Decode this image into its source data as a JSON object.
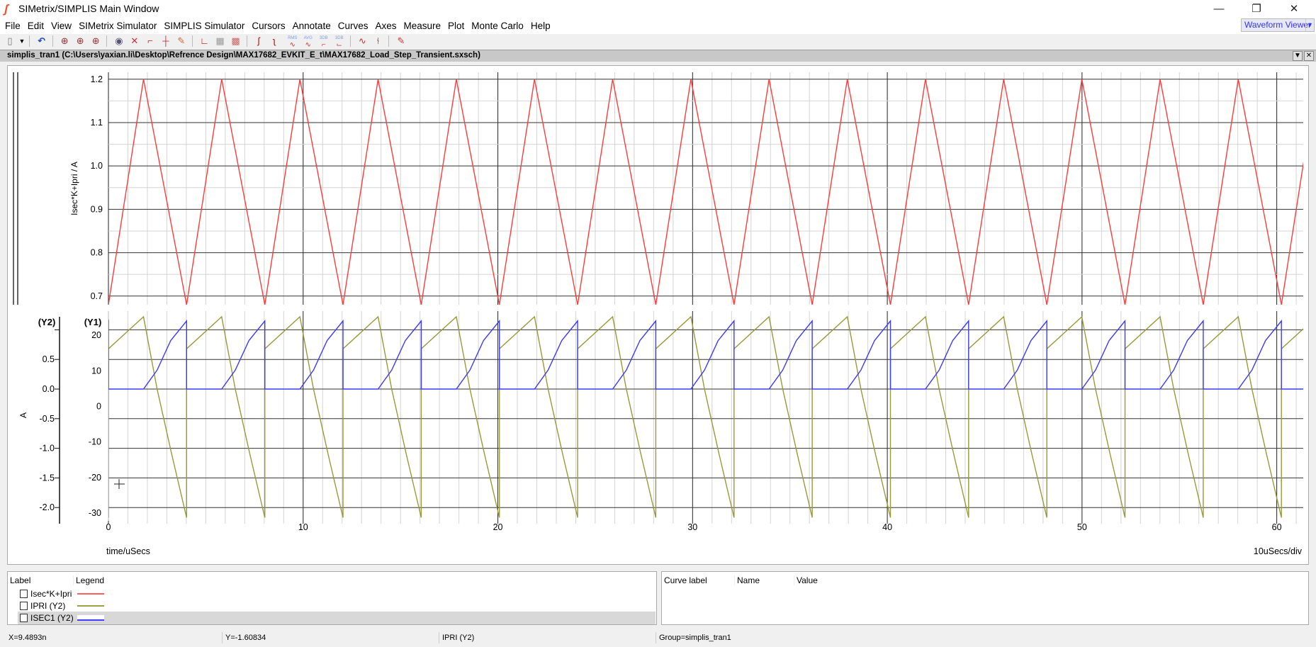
{
  "window": {
    "title": "SIMetrix/SIMPLIS Main Window",
    "minimize": "—",
    "restore": "❐",
    "close": "✕"
  },
  "menu": [
    "File",
    "Edit",
    "View",
    "SIMetrix Simulator",
    "SIMPLIS Simulator",
    "Cursors",
    "Annotate",
    "Curves",
    "Axes",
    "Measure",
    "Plot",
    "Monte Carlo",
    "Help"
  ],
  "viewer_select": {
    "value": "Waveform Viewer"
  },
  "toolbar": {
    "icons": [
      "new-document",
      "dropdown",
      "undo",
      "zoom-full",
      "zoom-width",
      "zoom-box",
      "show-hide",
      "delete-curve",
      "add-label",
      "add-axis",
      "add-curve-edit",
      "axis-lines",
      "grid-lines",
      "grid-edit",
      "cursor-rise",
      "cursor-fall",
      "rms",
      "avg",
      "3db-low",
      "3db-high",
      "fourier",
      "histogram",
      "edit-colors"
    ],
    "labels": {
      "rms": "RMS",
      "avg": "AVG",
      "3db": "3DB"
    }
  },
  "document": {
    "title": "simplis_tran1 (C:\\Users\\yaxian.li\\Desktop\\Refrence Design\\MAX17682_EVKIT_E_t\\MAX17682_Load_Step_Transient.sxsch)"
  },
  "chart_data": [
    {
      "type": "line",
      "ylabel": "Isec*K+Ipri / A",
      "yticks": [
        "1.2",
        "1.1",
        "1.0",
        "0.9",
        "0.8",
        "0.7"
      ],
      "ylim": [
        0.68,
        1.216
      ],
      "xlim": [
        0,
        61.36
      ],
      "grid": true,
      "series": [
        {
          "name": "Isec*K+Ipri",
          "color": "#ff3b3b",
          "period": 4.016,
          "cycle_points": [
            [
              0,
              0.68
            ],
            [
              1.8,
              1.2
            ],
            [
              4.016,
              0.68
            ]
          ]
        }
      ]
    },
    {
      "type": "line",
      "ylabel": "A",
      "y2_label": "(Y2)",
      "y1_label": "(Y1)",
      "y2_ticks": [
        "0.5",
        "0.0",
        "-0.5",
        "-1.0",
        "-1.5",
        "-2.0"
      ],
      "y1_ticks": [
        "20",
        "10",
        "0",
        "-10",
        "-20",
        "-30"
      ],
      "y2lim": [
        -2.225,
        1.316
      ],
      "y1lim": [
        -32.2,
        26.8
      ],
      "xlim": [
        0,
        61.36
      ],
      "grid": true,
      "xlabel": "time/uSecs",
      "xticks": [
        "0",
        "10",
        "20",
        "30",
        "40",
        "50",
        "60"
      ],
      "scale_note": "10uSecs/div",
      "series": [
        {
          "name": "IPRI (Y2)",
          "color": "#9a9a3a",
          "period": 4.016,
          "cycle_points": [
            [
              0,
              -2.17
            ],
            [
              0,
              0.68
            ],
            [
              1.8,
              1.22
            ],
            [
              2.5,
              0.0
            ],
            [
              3.25,
              -1.1
            ],
            [
              4.016,
              -2.17
            ]
          ]
        },
        {
          "name": "ISEC1 (Y2)",
          "color": "#3b3bff",
          "period": 4.016,
          "start_value": 1.17,
          "cycle_points": [
            [
              0,
              0
            ],
            [
              1.8,
              0
            ],
            [
              2.5,
              0.32
            ],
            [
              3.2,
              0.82
            ],
            [
              4.016,
              1.15
            ],
            [
              4.016,
              0
            ]
          ]
        }
      ]
    }
  ],
  "legend": {
    "headers": {
      "label": "Label",
      "legend": "Legend"
    },
    "items": [
      {
        "name": "Isec*K+Ipri",
        "color": "#ff6060"
      },
      {
        "name": "IPRI (Y2)",
        "color": "#a0a040"
      },
      {
        "name": "ISEC1 (Y2)",
        "color": "#4040ff"
      }
    ]
  },
  "curve_panel": {
    "headers": {
      "curve_label": "Curve label",
      "name": "Name",
      "value": "Value"
    }
  },
  "status": {
    "x": "X=9.4893n",
    "y": "Y=-1.60834",
    "curve": "IPRI (Y2)",
    "group": "Group=simplis_tran1"
  }
}
